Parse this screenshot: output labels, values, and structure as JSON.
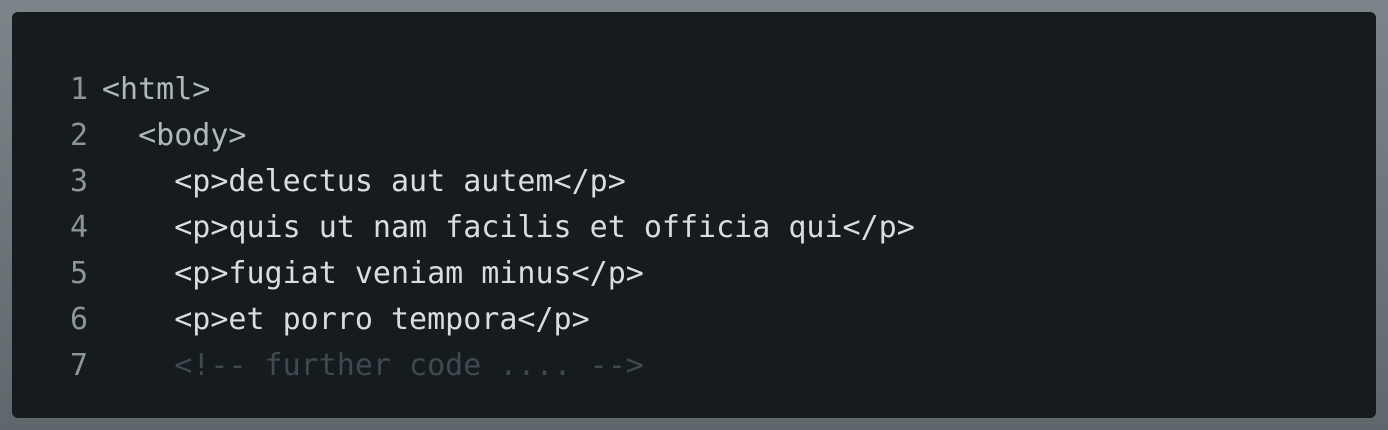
{
  "editor": {
    "lines": [
      {
        "number": "1",
        "content": "<html>"
      },
      {
        "number": "2",
        "content": "  <body>"
      },
      {
        "number": "3",
        "content": "    <p>delectus aut autem</p>"
      },
      {
        "number": "4",
        "content": "    <p>quis ut nam facilis et officia qui</p>"
      },
      {
        "number": "5",
        "content": "    <p>fugiat veniam minus</p>"
      },
      {
        "number": "6",
        "content": "    <p>et porro tempora</p>"
      },
      {
        "number": "7",
        "content": "    <!-- further code .... -->"
      }
    ],
    "colors": {
      "background": "#161b1e",
      "text": "#c9d1d6",
      "line_number": "#8b959b",
      "comment": "#3d4a52"
    }
  }
}
